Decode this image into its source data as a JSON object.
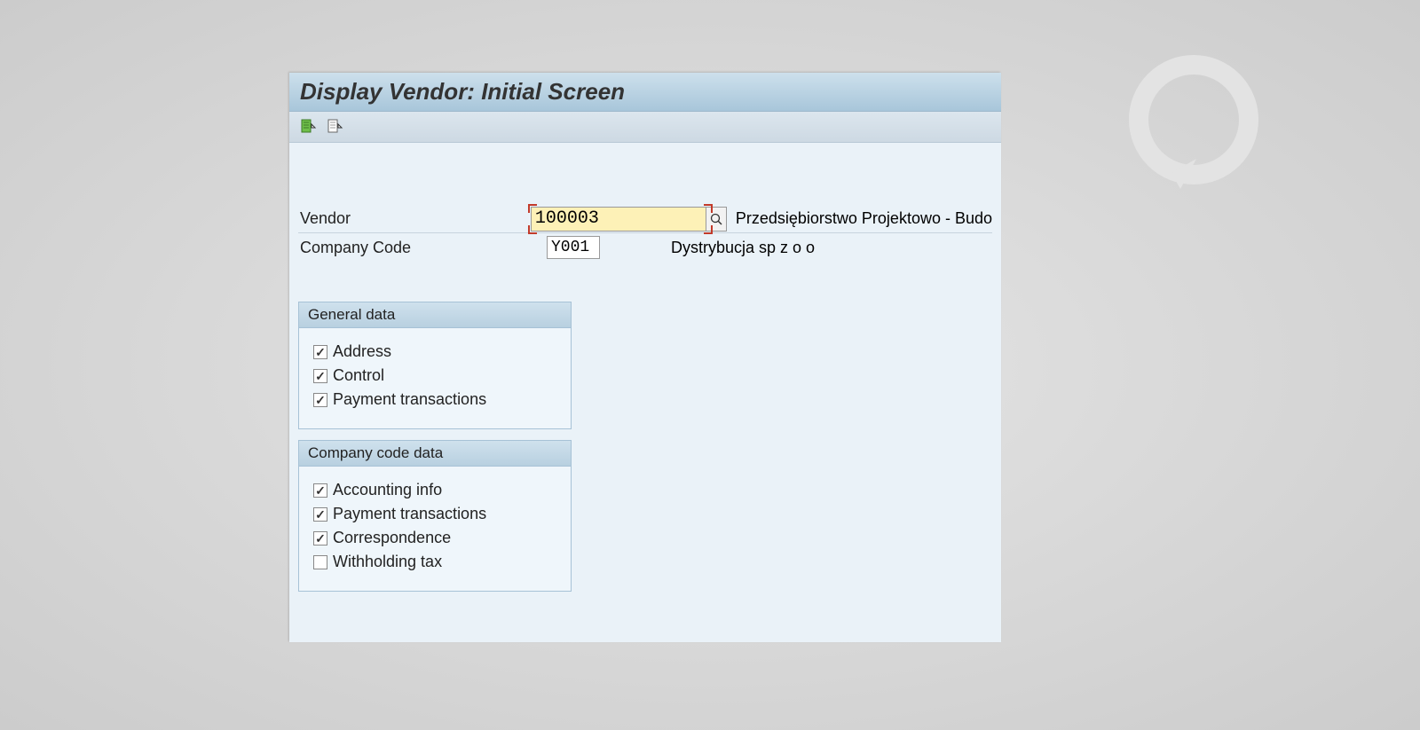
{
  "title": "Display Vendor:  Initial Screen",
  "fields": {
    "vendor_label": "Vendor",
    "vendor_value": "100003",
    "vendor_desc": "Przedsiębiorstwo Projektowo - Budo",
    "company_code_label": "Company Code",
    "company_code_value": "Y001",
    "company_code_desc": "Dystrybucja sp z o o"
  },
  "groups": {
    "general": {
      "title": "General data",
      "items": [
        {
          "label": "Address",
          "checked": true
        },
        {
          "label": "Control",
          "checked": true
        },
        {
          "label": "Payment transactions",
          "checked": true
        }
      ]
    },
    "company": {
      "title": "Company code data",
      "items": [
        {
          "label": "Accounting info",
          "checked": true
        },
        {
          "label": "Payment transactions",
          "checked": true
        },
        {
          "label": "Correspondence",
          "checked": true
        },
        {
          "label": "Withholding tax",
          "checked": false
        }
      ]
    }
  }
}
